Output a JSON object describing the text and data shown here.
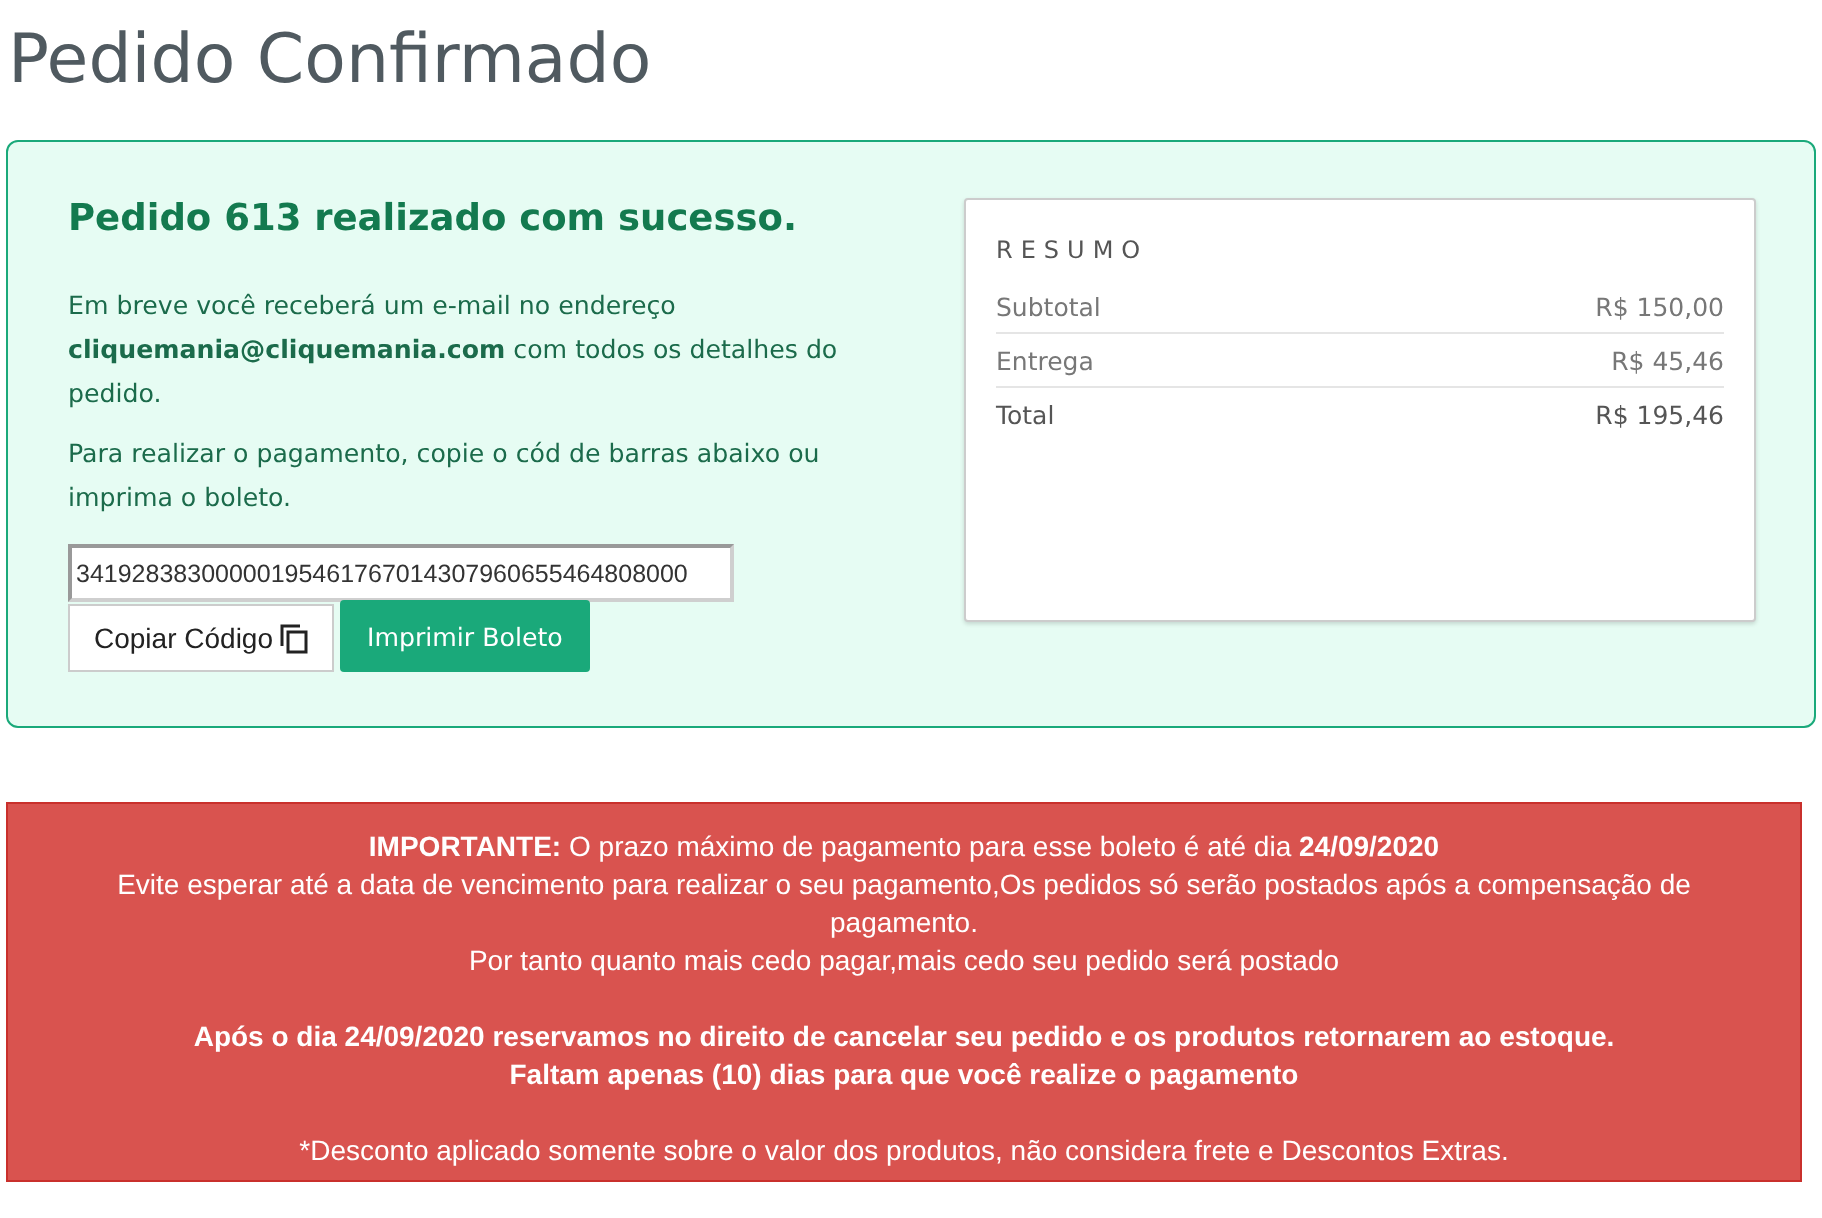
{
  "page_title": "Pedido Confirmado",
  "success": {
    "heading": "Pedido 613 realizado com sucesso.",
    "email_text": "Em breve você receberá um e-mail no endereço **cliquemania@cliquemania.com**  com todos os detalhes do pedido.",
    "payment_text": "Para realizar o pagamento, copie o cód de barras abaixo ou imprima o boleto.",
    "barcode_field": {
      "value": "34192838300000195461767014307960655464808000"
    },
    "buttons": [
      {
        "kind": "copy",
        "label": "Copiar Código"
      },
      {
        "kind": "print",
        "label": "Imprimir Boleto"
      }
    ]
  },
  "summary": {
    "title": "RESUMO",
    "rows": [
      {
        "label": "Subtotal",
        "value": "R$ 150,00",
        "kind": "line"
      },
      {
        "label": "Entrega",
        "value": "R$ 45,46",
        "kind": "line"
      },
      {
        "label": "Total",
        "value": "R$ 195,46",
        "kind": "total"
      }
    ]
  },
  "notice": {
    "lines": [
      {
        "kind": "normal",
        "text": "**IMPORTANTE:** O prazo máximo de pagamento para esse boleto é até dia **24/09/2020**"
      },
      {
        "kind": "normal",
        "text": "Evite esperar até a data de vencimento para realizar o seu pagamento,Os pedidos só serão postados após a compensação de pagamento."
      },
      {
        "kind": "normal",
        "text": "Por tanto quanto mais cedo pagar,mais cedo seu pedido será postado"
      },
      {
        "kind": "gap"
      },
      {
        "kind": "bold",
        "text": "Após o dia 24/09/2020 reservamos no direito de cancelar seu pedido e os produtos retornarem ao estoque."
      },
      {
        "kind": "bold",
        "text": "Faltam apenas (10) dias para que você realize o pagamento"
      },
      {
        "kind": "gap"
      },
      {
        "kind": "normal",
        "text": "*Desconto aplicado somente sobre o valor dos produtos, não considera frete e Descontos Extras."
      }
    ]
  }
}
